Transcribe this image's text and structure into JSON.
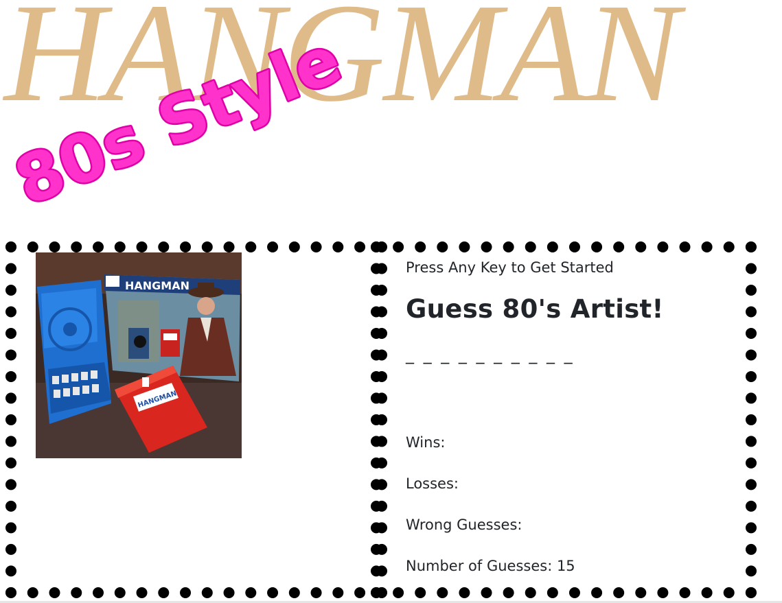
{
  "header": {
    "title": "HANGMAN",
    "title_color": "#e0bb8a",
    "subtitle": "80s Style",
    "subtitle_color": "#ff33cc",
    "subtitle_outline_color": "#e000a8"
  },
  "game_image": {
    "description_icon": "hangman-board-game-photo",
    "box_label": "HANGMAN",
    "case_label": "HANGMAN"
  },
  "game": {
    "instructions": "Press Any Key to Get Started",
    "heading": "Guess 80's Artist!",
    "word_blanks": "_ _ _ _ _ _ _ _ _ _",
    "wins_label": "Wins:",
    "losses_label": "Losses:",
    "wrong_guesses_label": "Wrong Guesses:",
    "number_of_guesses_label": "Number of Guesses: 15"
  }
}
